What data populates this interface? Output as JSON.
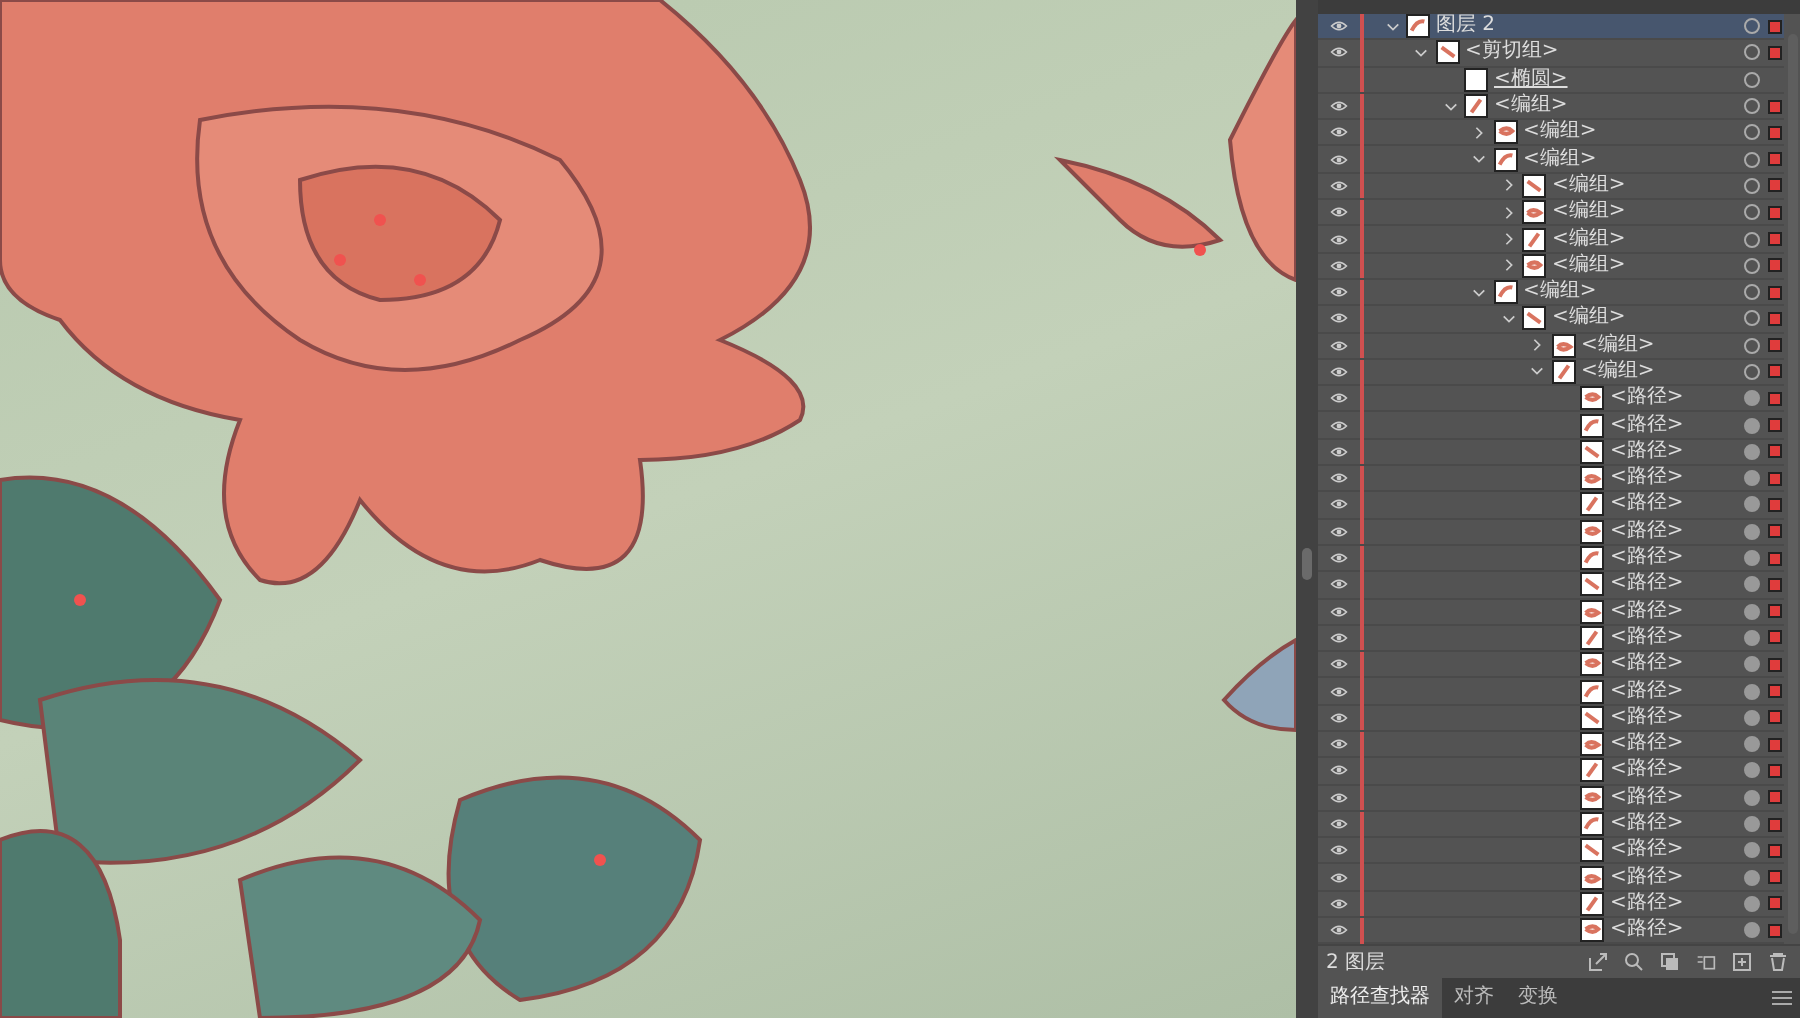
{
  "layers_panel": {
    "rows": [
      {
        "label": "图层 2",
        "kind": "group",
        "visible": true,
        "expanded": true,
        "selected": true,
        "art_selected": true,
        "children": [
          {
            "label": "<剪切组>",
            "kind": "group",
            "visible": true,
            "expanded": true,
            "selected": false,
            "art_selected": true,
            "children": [
              {
                "label": "<椭圆>",
                "kind": "clip",
                "visible": false,
                "selected": false,
                "art_selected": false
              },
              {
                "label": "<编组>",
                "kind": "group",
                "visible": true,
                "expanded": true,
                "selected": false,
                "art_selected": true,
                "children": [
                  {
                    "label": "<编组>",
                    "kind": "group",
                    "visible": true,
                    "expanded": false,
                    "selected": false,
                    "art_selected": true
                  },
                  {
                    "label": "<编组>",
                    "kind": "group",
                    "visible": true,
                    "expanded": true,
                    "selected": false,
                    "art_selected": true,
                    "children": [
                      {
                        "label": "<编组>",
                        "kind": "group",
                        "visible": true,
                        "expanded": false,
                        "selected": false,
                        "art_selected": true
                      },
                      {
                        "label": "<编组>",
                        "kind": "group",
                        "visible": true,
                        "expanded": false,
                        "selected": false,
                        "art_selected": true
                      },
                      {
                        "label": "<编组>",
                        "kind": "group",
                        "visible": true,
                        "expanded": false,
                        "selected": false,
                        "art_selected": true
                      },
                      {
                        "label": "<编组>",
                        "kind": "group",
                        "visible": true,
                        "expanded": false,
                        "selected": false,
                        "art_selected": true
                      }
                    ]
                  },
                  {
                    "label": "<编组>",
                    "kind": "group",
                    "visible": true,
                    "expanded": true,
                    "selected": false,
                    "art_selected": true,
                    "children": [
                      {
                        "label": "<编组>",
                        "kind": "group",
                        "visible": true,
                        "expanded": true,
                        "selected": false,
                        "art_selected": true,
                        "children": [
                          {
                            "label": "<编组>",
                            "kind": "group",
                            "visible": true,
                            "expanded": false,
                            "selected": false,
                            "art_selected": true
                          },
                          {
                            "label": "<编组>",
                            "kind": "group",
                            "visible": true,
                            "expanded": true,
                            "selected": false,
                            "art_selected": true,
                            "children": [
                              {
                                "label": "<路径>",
                                "kind": "path",
                                "visible": true,
                                "selected": false,
                                "art_selected": true
                              },
                              {
                                "label": "<路径>",
                                "kind": "path",
                                "visible": true,
                                "selected": false,
                                "art_selected": true
                              },
                              {
                                "label": "<路径>",
                                "kind": "path",
                                "visible": true,
                                "selected": false,
                                "art_selected": true
                              },
                              {
                                "label": "<路径>",
                                "kind": "path",
                                "visible": true,
                                "selected": false,
                                "art_selected": true
                              },
                              {
                                "label": "<路径>",
                                "kind": "path",
                                "visible": true,
                                "selected": false,
                                "art_selected": true
                              },
                              {
                                "label": "<路径>",
                                "kind": "path",
                                "visible": true,
                                "selected": false,
                                "art_selected": true
                              },
                              {
                                "label": "<路径>",
                                "kind": "path",
                                "visible": true,
                                "selected": false,
                                "art_selected": true
                              },
                              {
                                "label": "<路径>",
                                "kind": "path",
                                "visible": true,
                                "selected": false,
                                "art_selected": true
                              },
                              {
                                "label": "<路径>",
                                "kind": "path",
                                "visible": true,
                                "selected": false,
                                "art_selected": true
                              },
                              {
                                "label": "<路径>",
                                "kind": "path",
                                "visible": true,
                                "selected": false,
                                "art_selected": true
                              },
                              {
                                "label": "<路径>",
                                "kind": "path",
                                "visible": true,
                                "selected": false,
                                "art_selected": true
                              },
                              {
                                "label": "<路径>",
                                "kind": "path",
                                "visible": true,
                                "selected": false,
                                "art_selected": true
                              },
                              {
                                "label": "<路径>",
                                "kind": "path",
                                "visible": true,
                                "selected": false,
                                "art_selected": true
                              },
                              {
                                "label": "<路径>",
                                "kind": "path",
                                "visible": true,
                                "selected": false,
                                "art_selected": true
                              },
                              {
                                "label": "<路径>",
                                "kind": "path",
                                "visible": true,
                                "selected": false,
                                "art_selected": true
                              },
                              {
                                "label": "<路径>",
                                "kind": "path",
                                "visible": true,
                                "selected": false,
                                "art_selected": true
                              },
                              {
                                "label": "<路径>",
                                "kind": "path",
                                "visible": true,
                                "selected": false,
                                "art_selected": true
                              },
                              {
                                "label": "<路径>",
                                "kind": "path",
                                "visible": true,
                                "selected": false,
                                "art_selected": true
                              },
                              {
                                "label": "<路径>",
                                "kind": "path",
                                "visible": true,
                                "selected": false,
                                "art_selected": true
                              },
                              {
                                "label": "<路径>",
                                "kind": "path",
                                "visible": true,
                                "selected": false,
                                "art_selected": true
                              },
                              {
                                "label": "<路径>",
                                "kind": "path",
                                "visible": true,
                                "selected": false,
                                "art_selected": true
                              }
                            ]
                          }
                        ]
                      }
                    ]
                  }
                ]
              }
            ]
          }
        ]
      }
    ],
    "footer": {
      "count": "2 图层"
    }
  },
  "bottom_panel": {
    "tabs": [
      {
        "label": "路径查找器",
        "selected": true
      },
      {
        "label": "对齐",
        "selected": false
      },
      {
        "label": "变换",
        "selected": false
      }
    ]
  }
}
